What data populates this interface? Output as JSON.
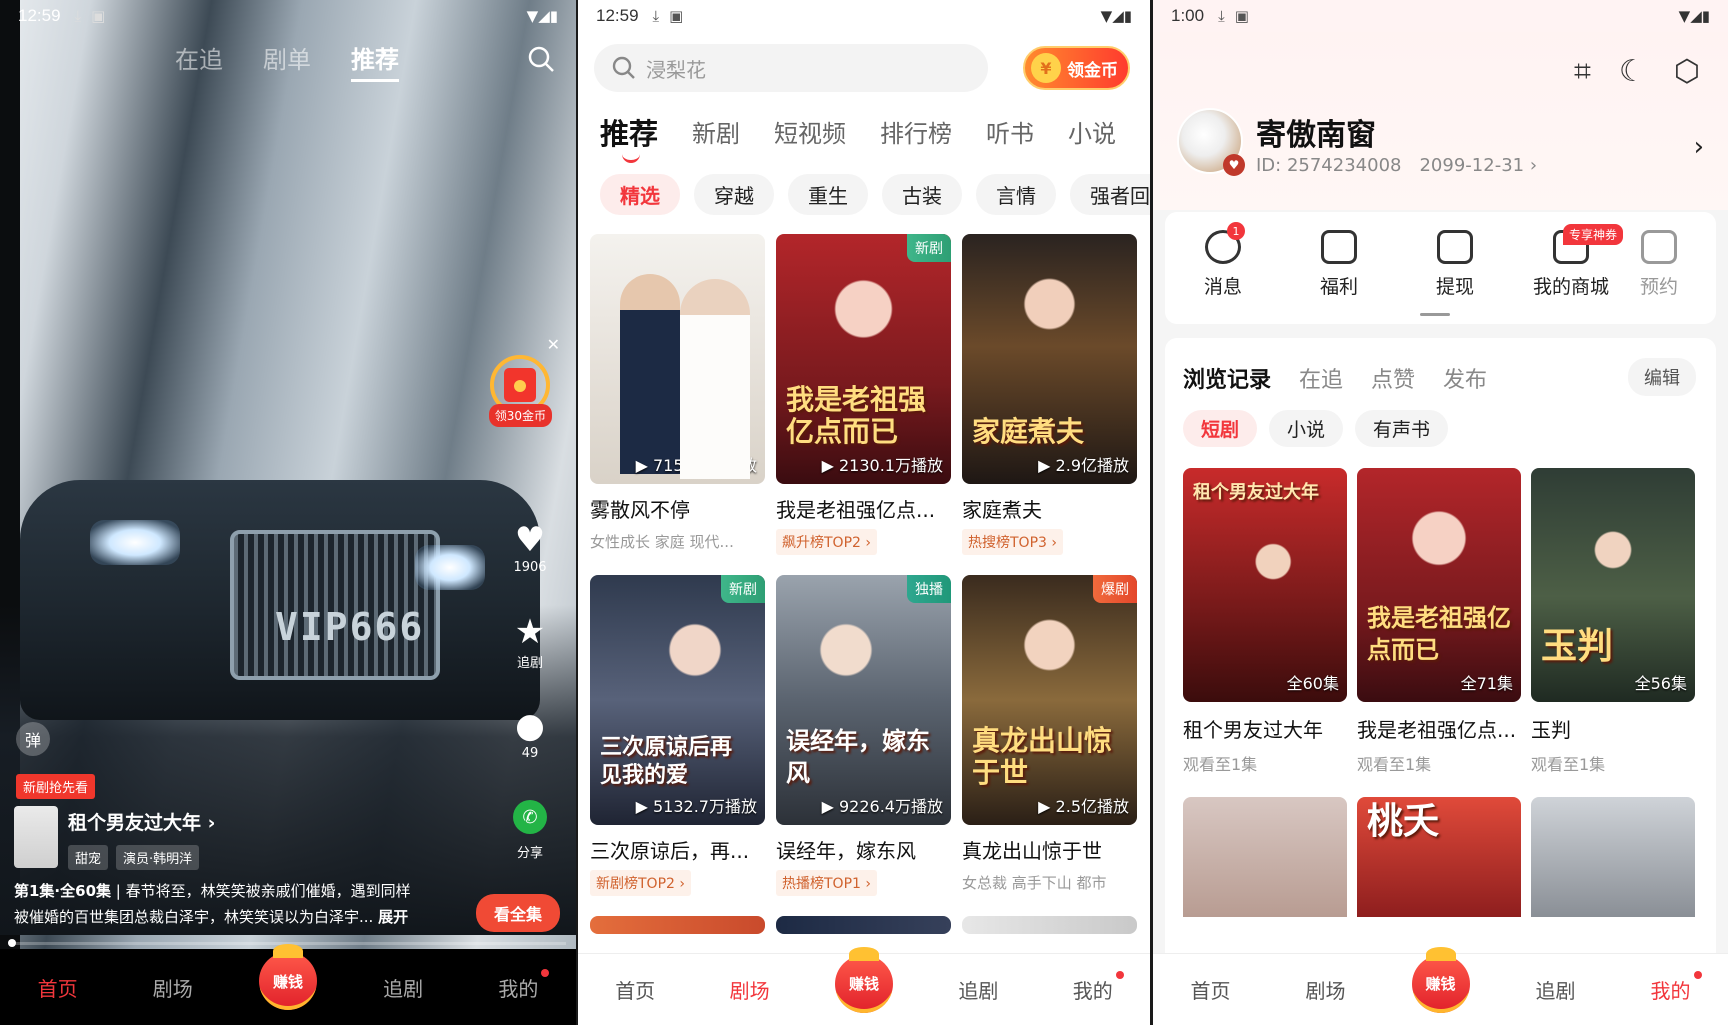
{
  "player": {
    "status_time": "12:59",
    "top_tabs": [
      "在追",
      "剧单",
      "推荐"
    ],
    "reward_label": "领30金币",
    "like_count": "1906",
    "follow_label": "追剧",
    "comment_count": "49",
    "share_label": "分享",
    "danmaku_label": "弹",
    "new_tag": "新剧抢先看",
    "drama_title": "租个男友过大年",
    "drama_tags": [
      "甜宠",
      "演员·韩明洋"
    ],
    "episode_info": "第1集·全60集",
    "desc_line1": "春节将至，林笑笑被亲戚们催婚，遇到同样",
    "desc_line2": "被催婚的百世集团总裁白泽宇，林笑笑误以为白泽宇...",
    "expand_label": "展开",
    "watch_all_label": "看全集",
    "plate_text": "VIP666"
  },
  "nav": {
    "items": [
      "首页",
      "剧场",
      "赚钱",
      "追剧",
      "我的"
    ]
  },
  "theater": {
    "status_time": "12:59",
    "search_placeholder": "浸梨花",
    "coin_button": "领金币",
    "coin_symbol": "¥",
    "tabs": [
      "推荐",
      "新剧",
      "短视频",
      "排行榜",
      "听书",
      "小说"
    ],
    "chips": [
      "精选",
      "穿越",
      "重生",
      "古装",
      "言情",
      "强者回"
    ],
    "cards": [
      {
        "title": "雾散风不停",
        "sub": "女性成长 家庭 现代...",
        "plays": "▶ 7155.5万播放",
        "badge": "",
        "rank": "",
        "art": "",
        "poster_text": ""
      },
      {
        "title": "我是老祖强亿点...",
        "sub": "",
        "plays": "▶ 2130.1万播放",
        "badge": "新剧",
        "rank": "飙升榜TOP2 ›",
        "art": "我是老祖强亿点而已",
        "poster_text": "我是老祖强亿点而已"
      },
      {
        "title": "家庭煮夫",
        "sub": "",
        "plays": "▶ 2.9亿播放",
        "badge": "",
        "rank": "热搜榜TOP3 ›",
        "art": "家庭煮夫",
        "poster_text": "家庭煮夫"
      },
      {
        "title": "三次原谅后，再...",
        "sub": "",
        "plays": "▶ 5132.7万播放",
        "badge": "新剧",
        "rank": "新剧榜TOP2 ›",
        "art": "三次原谅后 再见我的爱",
        "poster_text": "三次原谅后再见我的爱"
      },
      {
        "title": "误经年，嫁东风",
        "sub": "",
        "plays": "▶ 9226.4万播放",
        "badge": "独播",
        "rank": "热播榜TOP1 ›",
        "art": "误经年 嫁东风",
        "poster_text": "误经年，嫁东风"
      },
      {
        "title": "真龙出山惊于世",
        "sub": "女总裁 高手下山 都市",
        "plays": "▶ 2.5亿播放",
        "badge": "爆剧",
        "rank": "",
        "art": "真龙出山惊于世",
        "poster_text": "真龙出山惊于世"
      }
    ]
  },
  "profile": {
    "status_time": "1:00",
    "username": "寄傲南窗",
    "user_id": "ID: 2574234008",
    "date": "2099-12-31 ›",
    "quick_actions": [
      "消息",
      "福利",
      "提现",
      "我的商城",
      "预约"
    ],
    "message_badge": "1",
    "mall_tag": "专享神券",
    "history_tabs": [
      "浏览记录",
      "在追",
      "点赞",
      "发布"
    ],
    "edit_label": "编辑",
    "history_chips": [
      "短剧",
      "小说",
      "有声书"
    ],
    "history": [
      {
        "title": "租个男友过大年",
        "progress": "观看至1集",
        "eps": "全60集",
        "poster_text": "租个男友过大年"
      },
      {
        "title": "我是老祖强亿点...",
        "progress": "观看至1集",
        "eps": "全71集",
        "poster_text": "我是老祖强亿点而已"
      },
      {
        "title": "玉判",
        "progress": "观看至1集",
        "eps": "全56集",
        "poster_text": "玉判"
      },
      {
        "title": "",
        "progress": "",
        "eps": "",
        "poster_text": ""
      },
      {
        "title": "",
        "progress": "",
        "eps": "",
        "poster_text": "桃夭"
      },
      {
        "title": "",
        "progress": "",
        "eps": "",
        "poster_text": ""
      }
    ]
  },
  "colors": {
    "accent_red": "#f2363c",
    "earn_gradient_top": "#ff5a4a",
    "wechat_green": "#23b446"
  }
}
